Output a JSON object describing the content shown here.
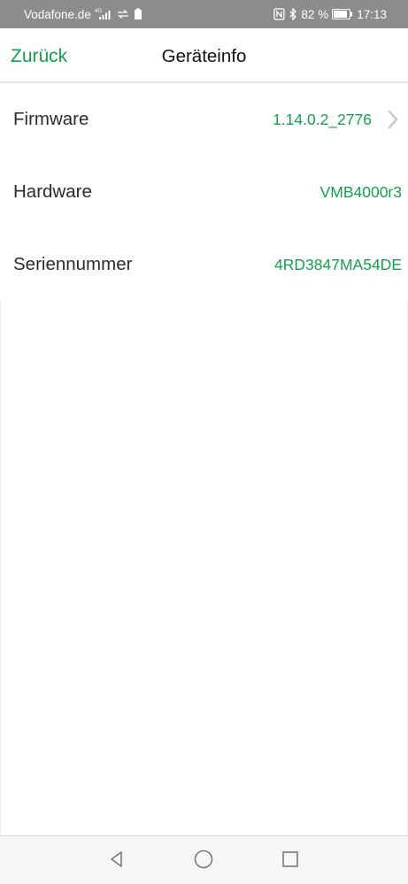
{
  "status_bar": {
    "carrier": "Vodafone.de",
    "network_type": "4G",
    "battery_percent": "82 %",
    "time": "17:13",
    "icons": [
      "signal-icon",
      "data-transfer-icon",
      "sim-icon",
      "nfc-icon",
      "bluetooth-icon",
      "battery-icon"
    ]
  },
  "header": {
    "back_label": "Zurück",
    "title": "Geräteinfo"
  },
  "info_rows": [
    {
      "label": "Firmware",
      "value": "1.14.0.2_2776",
      "has_chevron": true
    },
    {
      "label": "Hardware",
      "value": "VMB4000r3",
      "has_chevron": false
    },
    {
      "label": "Seriennummer",
      "value": "4RD3847MA54DE",
      "has_chevron": false
    }
  ],
  "nav_bar": {
    "icons": [
      "nav-back-icon",
      "nav-home-icon",
      "nav-recents-icon"
    ]
  },
  "colors": {
    "accent": "#13a04d",
    "status_bar": "#8c8c8c"
  }
}
